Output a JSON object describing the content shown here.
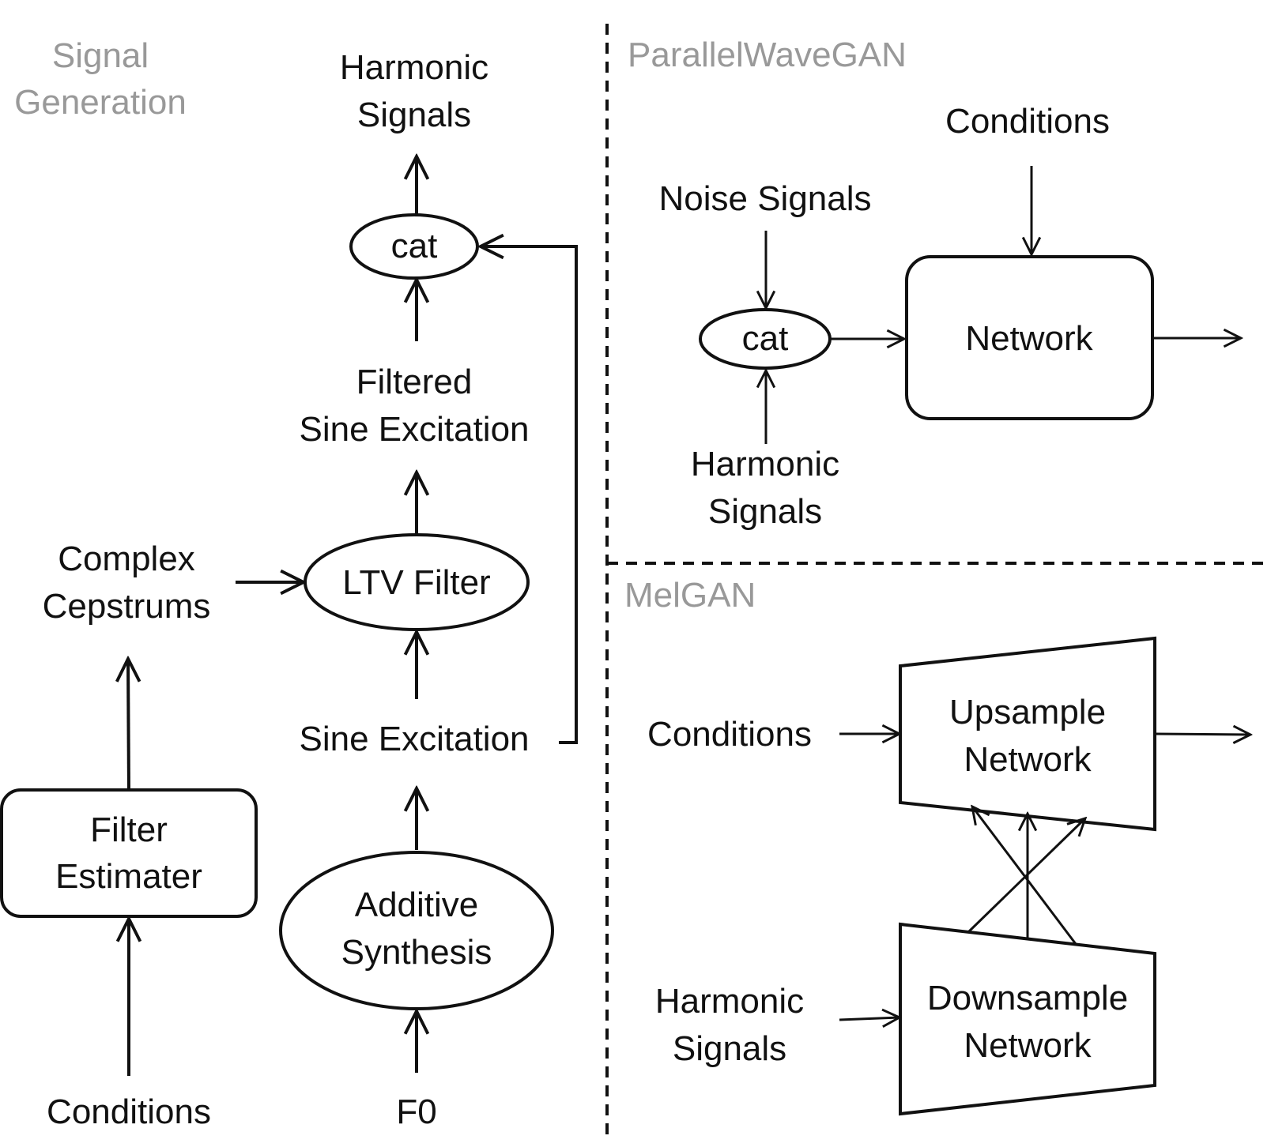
{
  "colors": {
    "stroke": "#111111",
    "section_label": "#999999",
    "background": "#ffffff"
  },
  "signal_generation": {
    "section_label_line1": "Signal",
    "section_label_line2": "Generation",
    "harmonic_signals_line1": "Harmonic",
    "harmonic_signals_line2": "Signals",
    "cat": "cat",
    "filtered_line1": "Filtered",
    "filtered_line2": "Sine Excitation",
    "complex_line1": "Complex",
    "complex_line2": "Cepstrums",
    "ltv_filter": "LTV Filter",
    "sine_excitation": "Sine Excitation",
    "filter_estimater_line1": "Filter",
    "filter_estimater_line2": "Estimater",
    "additive_line1": "Additive",
    "additive_line2": "Synthesis",
    "conditions": "Conditions",
    "f0": "F0"
  },
  "parallel_wavegan": {
    "section_label": "ParallelWaveGAN",
    "conditions": "Conditions",
    "noise_signals": "Noise Signals",
    "cat": "cat",
    "network": "Network",
    "harmonic_line1": "Harmonic",
    "harmonic_line2": "Signals"
  },
  "melgan": {
    "section_label": "MelGAN",
    "conditions": "Conditions",
    "upsample_line1": "Upsample",
    "upsample_line2": "Network",
    "harmonic_line1": "Harmonic",
    "harmonic_line2": "Signals",
    "downsample_line1": "Downsample",
    "downsample_line2": "Network"
  }
}
